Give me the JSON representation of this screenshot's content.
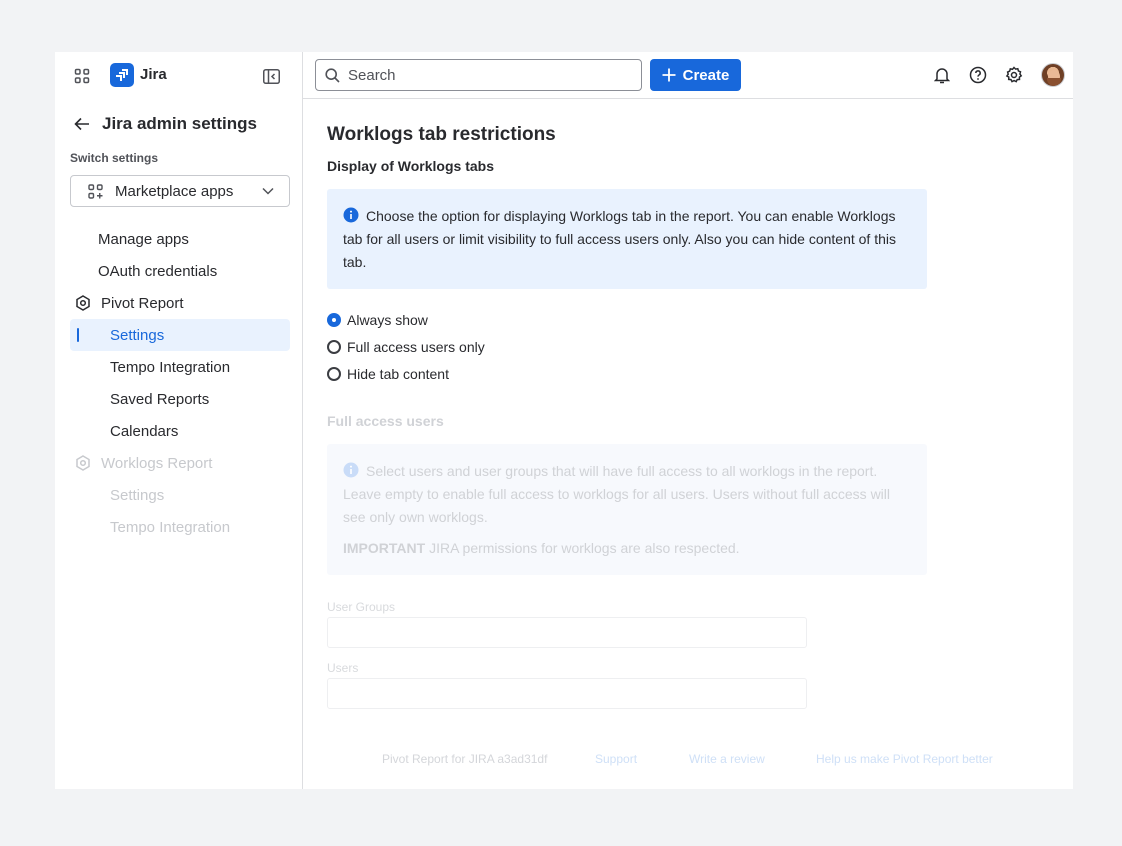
{
  "sidebar": {
    "app_name": "Jira",
    "back_title": "Jira admin settings",
    "switch_label": "Switch settings",
    "switch_value": "Marketplace apps",
    "items": [
      {
        "label": "Manage apps"
      },
      {
        "label": "OAuth credentials"
      },
      {
        "label": "Pivot Report"
      },
      {
        "label": "Settings"
      },
      {
        "label": "Tempo Integration"
      },
      {
        "label": "Saved Reports"
      },
      {
        "label": "Calendars"
      },
      {
        "label": "Worklogs Report"
      },
      {
        "label": "Settings"
      },
      {
        "label": "Tempo Integration"
      }
    ]
  },
  "topbar": {
    "search_placeholder": "Search",
    "create_label": "Create",
    "icons": [
      "notifications-icon",
      "help-icon",
      "settings-icon",
      "avatar"
    ]
  },
  "content": {
    "title": "Worklogs tab restrictions",
    "subtitle": "Display of Worklogs tabs",
    "info_text": "Choose the option for displaying Worklogs tab in the report. You can enable Worklogs tab for all users or limit visibility to full access users only. Also you can hide content of this tab.",
    "options": [
      {
        "label": "Always show",
        "checked": true
      },
      {
        "label": "Full access users only",
        "checked": false
      },
      {
        "label": "Hide tab content",
        "checked": false
      }
    ],
    "full_access_title": "Full access users",
    "full_access_info": "Select users and user groups that will have full access to all worklogs in the report. Leave empty to enable full access to worklogs for all users. Users without full access will see only own worklogs.",
    "important_label": "IMPORTANT",
    "important_text": "JIRA permissions for worklogs are also respected.",
    "user_groups_label": "User Groups",
    "users_label": "Users"
  },
  "footer": {
    "version": "Pivot Report for JIRA a3ad31df",
    "support": "Support",
    "review": "Write a review",
    "feedback": "Help us make Pivot Report better"
  },
  "colors": {
    "accent": "#1868db",
    "info_bg": "#e9f2fe",
    "active_nav_bg": "#e9f2fe"
  }
}
